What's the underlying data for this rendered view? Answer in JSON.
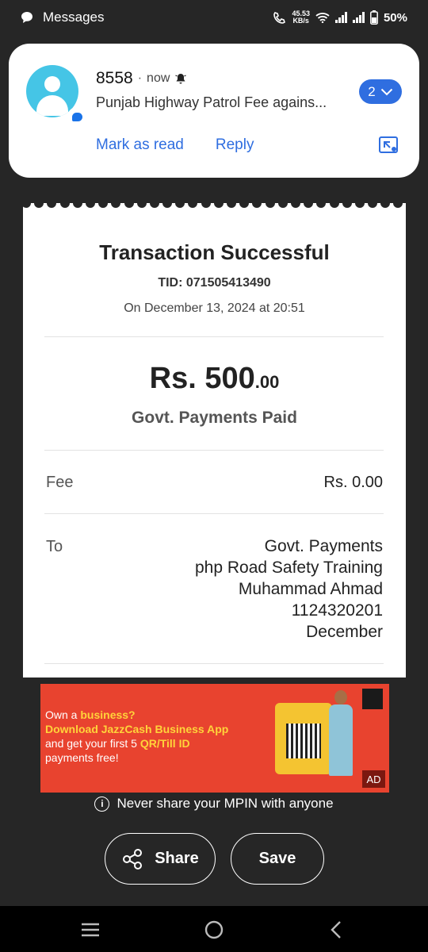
{
  "status_bar": {
    "app_label": "Messages",
    "net_speed_value": "45.53",
    "net_speed_unit": "KB/s",
    "battery": "50%"
  },
  "notification": {
    "sender": "8558",
    "dot": "·",
    "time": "now",
    "preview": "Punjab Highway Patrol Fee agains...",
    "count": "2",
    "mark_read": "Mark as read",
    "reply": "Reply"
  },
  "receipt": {
    "title": "Transaction Successful",
    "tid": "TID: 071505413490",
    "date": "On December 13, 2024 at 20:51",
    "amount_main": "Rs. 500",
    "amount_decimal": ".00",
    "paid_label": "Govt. Payments Paid",
    "fee_label": "Fee",
    "fee_value": "Rs. 0.00",
    "to_label": "To",
    "to_lines": [
      "Govt. Payments",
      "php Road Safety Training",
      "Muhammad Ahmad",
      "1124320201",
      "December"
    ]
  },
  "ad": {
    "line1_pre": "Own a ",
    "line1_em": "business?",
    "line2": "Download JazzCash Business App",
    "line3": "and get your first 5 ",
    "line3_em": "QR/Till ID",
    "line4": "payments free!",
    "tag": "AD"
  },
  "security_note": "Never share your MPIN with anyone",
  "actions": {
    "share": "Share",
    "save": "Save"
  },
  "colors": {
    "background": "#262626",
    "accent_blue": "#2f6ee0",
    "avatar": "#45c5e6",
    "ad_red": "#e8432f"
  }
}
